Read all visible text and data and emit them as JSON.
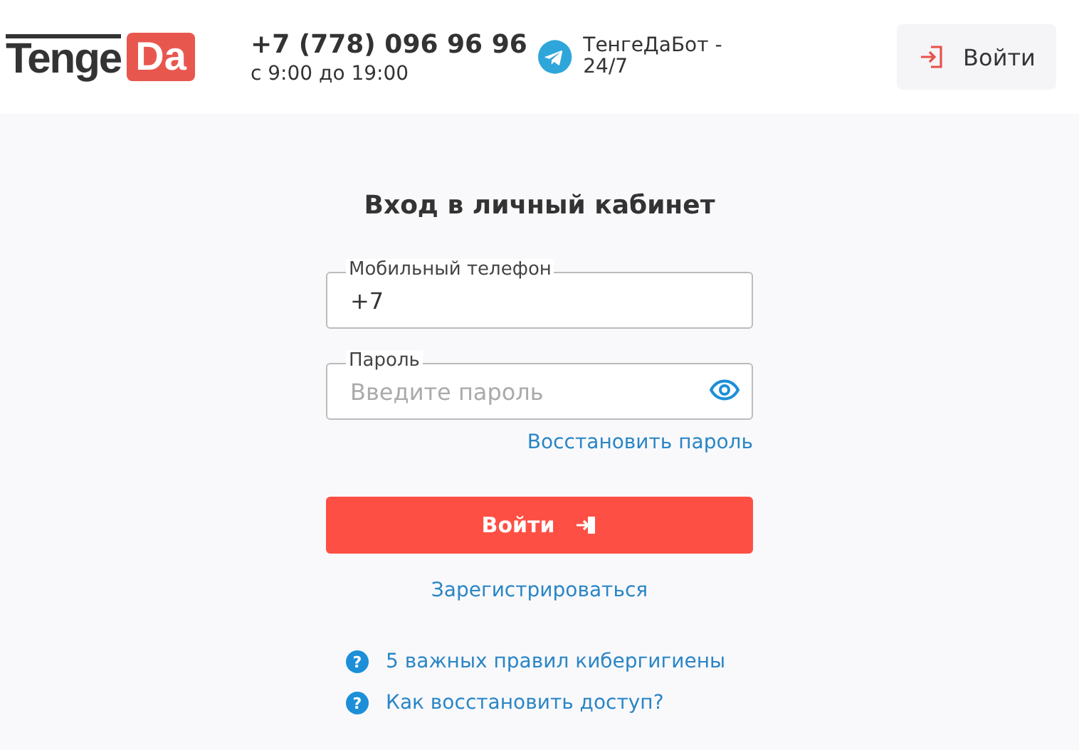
{
  "header": {
    "logo": {
      "part_1": "Tenge",
      "part_2": "Da"
    },
    "phone": "+7 (778) 096 96 96",
    "hours": "с 9:00 до 19:00",
    "bot": "ТенгеДаБот - 24/7",
    "login_button": "Войти"
  },
  "form": {
    "title": "Вход в личный кабинет",
    "fields": [
      {
        "kind": "text",
        "label": "Мобильный телефон",
        "value": "+7"
      },
      {
        "kind": "password",
        "label": "Пароль",
        "placeholder": "Введите пароль"
      }
    ],
    "forgot_link": "Восстановить пароль",
    "submit": "Войти",
    "register_link": "Зарегистрироваться"
  },
  "help_links": [
    {
      "icon": "?",
      "text": "5 важных правил кибергигиены"
    },
    {
      "icon": "?",
      "text": "Как восстановить доступ?"
    }
  ]
}
